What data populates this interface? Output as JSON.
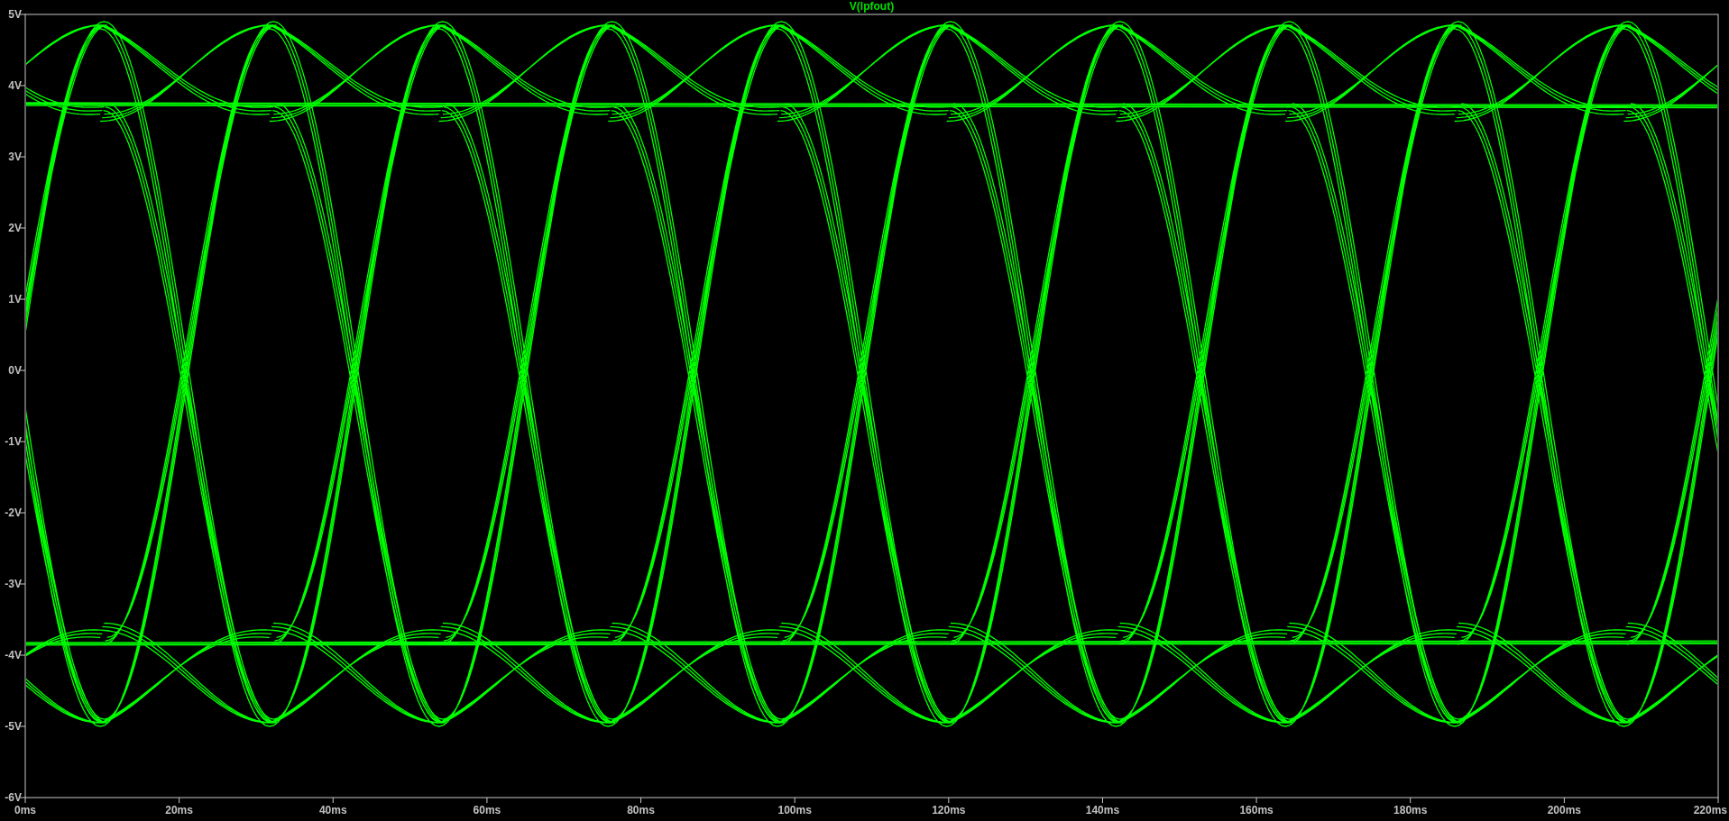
{
  "plot": {
    "title": "V(lpfout)",
    "y_ticks": [
      "5V",
      "4V",
      "3V",
      "2V",
      "1V",
      "0V",
      "-1V",
      "-2V",
      "-3V",
      "-4V",
      "-5V",
      "-6V"
    ],
    "x_ticks": [
      "0ms",
      "20ms",
      "40ms",
      "60ms",
      "80ms",
      "100ms",
      "120ms",
      "140ms",
      "160ms",
      "180ms",
      "200ms",
      "220ms"
    ]
  }
}
